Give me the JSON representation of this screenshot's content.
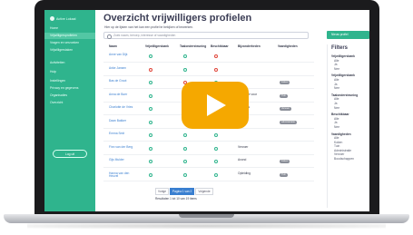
{
  "brand": {
    "name": "Active Lokaal"
  },
  "sidebar": {
    "items": [
      {
        "label": "Home"
      },
      {
        "label": "Vrijwilligersprofielen"
      },
      {
        "label": "Vragen en verzoeken"
      },
      {
        "label": "Vrijwilligerstaken"
      },
      {
        "label": "Activiteiten"
      },
      {
        "label": "Hulp"
      },
      {
        "label": "Instellingen"
      },
      {
        "label": "Privacy en gegevens"
      },
      {
        "label": "Organisaties"
      },
      {
        "label": "Overzicht"
      }
    ],
    "logout_label": "Log uit"
  },
  "page": {
    "title": "Overzicht vrijwilligers profielen",
    "subtitle": "Hier op de lijsten van het kan een profiel te bekijken of bewerken.",
    "search_placeholder": "Zoek naam, beroep, interesse of vaardigheden",
    "top_button_label": "Nieuw profiel"
  },
  "table": {
    "columns": [
      "Naam",
      "Vrijwilligersbank",
      "Taalondersteuning",
      "Beschikbaar",
      "Bijzonderheden",
      "Vaardigheden"
    ],
    "rows": [
      {
        "name": "Anne van Dijk",
        "c1": "green",
        "c2": "green",
        "c3": "red",
        "note": "",
        "tag": ""
      },
      {
        "name": "Anke Jansen",
        "c1": "red",
        "c2": "green",
        "c3": "red",
        "note": "",
        "tag": ""
      },
      {
        "name": "Bas de Groot",
        "c1": "green",
        "c2": "red",
        "c3": "green",
        "note": "",
        "tag": "Koken"
      },
      {
        "name": "Anna de Boer",
        "c1": "green",
        "c2": "green",
        "c3": "green",
        "note": "Bijzonder voor contact",
        "tag": "Tuin"
      },
      {
        "name": "Charlotte de Vries",
        "c1": "green",
        "c2": "green",
        "c3": "green",
        "note": "Rijbewijs",
        "tag": "Vervoer"
      },
      {
        "name": "Daan Bakker",
        "c1": "green",
        "c2": "green",
        "c3": "green",
        "note": "",
        "tag": "Administratie"
      },
      {
        "name": "Emma Smit",
        "c1": "green",
        "c2": "green",
        "c3": "green",
        "note": "",
        "tag": ""
      },
      {
        "name": "Finn van der Berg",
        "c1": "green",
        "c2": "green",
        "c3": "green",
        "note": "Vervoer",
        "tag": ""
      },
      {
        "name": "Gijs Mulder",
        "c1": "green",
        "c2": "green",
        "c3": "green",
        "note": "Avond",
        "tag": "Koken"
      },
      {
        "name": "Hanna van den Heuvel",
        "c1": "green",
        "c2": "green",
        "c3": "green",
        "note": "Opleiding",
        "tag": "Tuin"
      }
    ]
  },
  "pagination": {
    "items": [
      "Vorige",
      "Pagina 1 van 2",
      "Volgende"
    ],
    "result_count": "Resultaten 1 tot 10 van 19 items"
  },
  "filters": {
    "title": "Filters",
    "groups": [
      {
        "label": "Vrijwilligersbank",
        "options": [
          "Alle",
          "Ja",
          "Nee"
        ]
      },
      {
        "label": "Vrijwilligersbank",
        "options": [
          "Alle",
          "Ja",
          "Nee"
        ]
      },
      {
        "label": "Taalondersteuning",
        "options": [
          "Alle",
          "Ja",
          "Nee"
        ]
      },
      {
        "label": "Beschikbaar",
        "options": [
          "Alle",
          "Ja",
          "Nee"
        ]
      },
      {
        "label": "Vaardigheden",
        "options": [
          "Alle",
          "Koken",
          "Tuin",
          "Administratie",
          "Vervoer",
          "Boodschappen"
        ]
      }
    ]
  },
  "video": {
    "play_icon": "play-icon"
  }
}
